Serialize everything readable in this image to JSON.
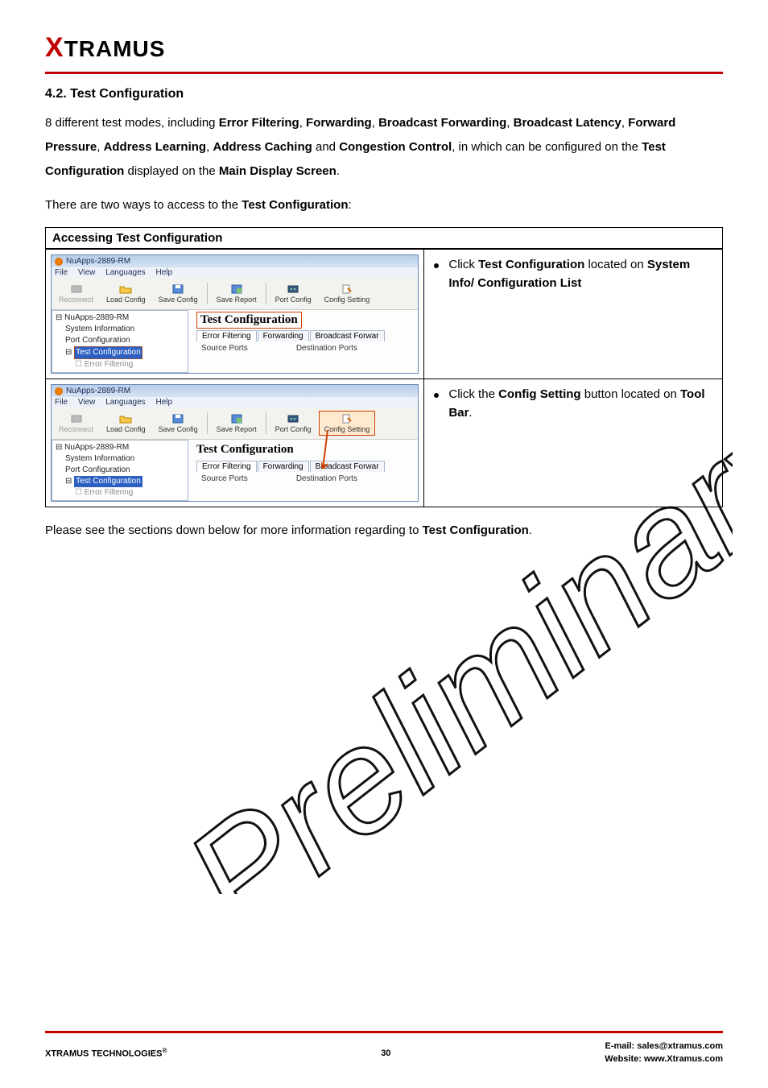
{
  "brand": {
    "x": "X",
    "rest": "TRAMUS"
  },
  "section_title": "4.2. Test Configuration",
  "intro_parts": {
    "p1a": "8 different test modes, including ",
    "b1": "Error Filtering",
    "c1": ", ",
    "b2": "Forwarding",
    "c2": ", ",
    "b3": "Broadcast Forwarding",
    "c3": ", ",
    "b4": "Broadcast Latency",
    "c4": ", ",
    "b5": "Forward Pressure",
    "c5": ", ",
    "b6": "Address Learning",
    "c6": ", ",
    "b7": "Address Caching",
    "c7": " and ",
    "b8": "Congestion Control",
    "p1b": ", in which can be configured on the ",
    "b9": "Test Configuration",
    "p1c": " displayed on the ",
    "b10": "Main Display Screen",
    "p1d": "."
  },
  "intro2_parts": {
    "a": "There are two ways to access to the ",
    "b": "Test Configuration",
    "c": ":"
  },
  "table_header": "Accessing Test Configuration",
  "row1_desc": {
    "a": "Click ",
    "b": "Test Configuration",
    "c": " located on ",
    "d": "System Info/ Configuration List"
  },
  "row2_desc": {
    "a": "Click the ",
    "b": "Config Setting",
    "c": " button located on ",
    "d": "Tool Bar",
    "e": "."
  },
  "closing_parts": {
    "a": "Please see the sections down below for more information regarding to ",
    "b": "Test Configuration",
    "c": "."
  },
  "app": {
    "title": "NuApps-2889-RM",
    "menus": [
      "File",
      "View",
      "Languages",
      "Help"
    ],
    "tools": {
      "reconnect": "Reconnect",
      "load": "Load Config",
      "save": "Save Config",
      "report": "Save Report",
      "port": "Port Config",
      "setting": "Config Setting"
    },
    "tree": {
      "root": "NuApps-2889-RM",
      "sysinfo": "System Information",
      "portconf": "Port Configuration",
      "testconf": "Test Configuration",
      "errfilt": "Error Filtering"
    },
    "content_title": "Test Configuration",
    "tabs": [
      "Error Filtering",
      "Forwarding",
      "Broadcast Forwar"
    ],
    "tabs2": [
      "Error Filtering",
      "Forwarding",
      "Broadcast Forwar"
    ],
    "sub_src": "Source Ports",
    "sub_dst": "Destination Ports"
  },
  "footer": {
    "left_a": "XTRAMUS TECHNOLOGIES",
    "left_sup": "®",
    "page": "30",
    "email_label": "E-mail: ",
    "email": "sales@xtramus.com",
    "site_label": "Website:  ",
    "site": "www.Xtramus.com"
  }
}
